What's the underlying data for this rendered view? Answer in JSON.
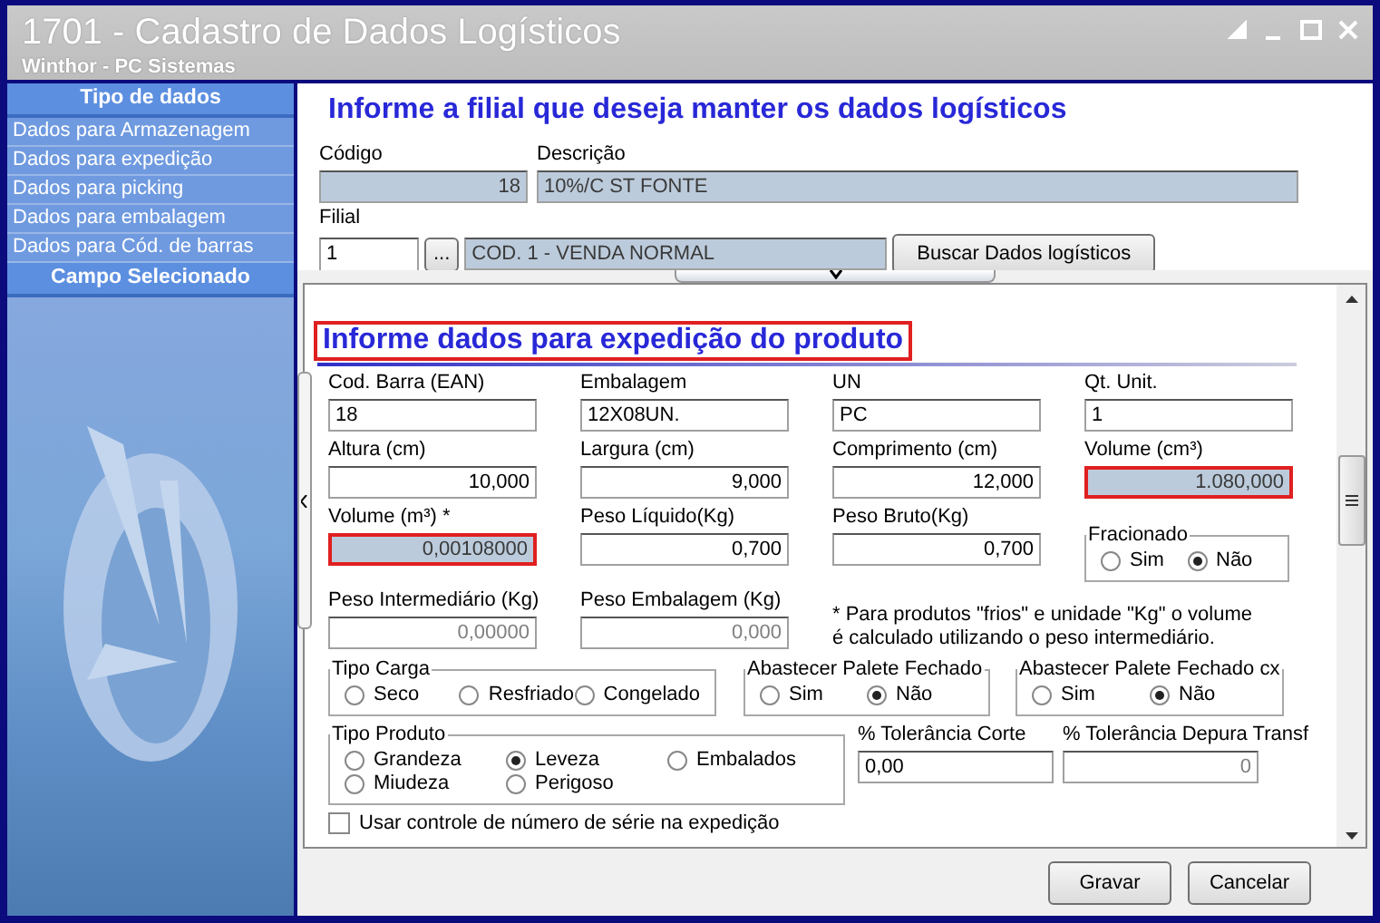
{
  "window": {
    "title": "1701 - Cadastro de Dados Logísticos",
    "subtitle": "Winthor - PC Sistemas"
  },
  "sidebar": {
    "header": "Tipo de dados",
    "items": [
      "Dados para Armazenagem",
      "Dados para expedição",
      "Dados para picking",
      "Dados para embalagem",
      "Dados para Cód. de barras"
    ],
    "footer_header": "Campo Selecionado"
  },
  "filial_section": {
    "heading": "Informe a filial que deseja manter os dados logísticos",
    "codigo": {
      "label": "Código",
      "value": "18",
      "readonly": true
    },
    "descricao": {
      "label": "Descrição",
      "value": "10%/C ST FONTE",
      "readonly": true
    },
    "filial": {
      "label": "Filial",
      "value": "1",
      "lookup_button": "...",
      "description": "COD. 1 - VENDA NORMAL"
    },
    "search_button": "Buscar Dados logísticos"
  },
  "expedicao": {
    "heading": "Informe dados para expedição do produto",
    "highlighted": true,
    "rows": [
      [
        {
          "kind": "text_field",
          "label": "Cod. Barra (EAN)",
          "value": "18"
        },
        {
          "kind": "text_field",
          "label": "Embalagem",
          "value": "12X08UN."
        },
        {
          "kind": "text_field",
          "label": "UN",
          "value": "PC"
        },
        {
          "kind": "text_field",
          "label": "Qt. Unit.",
          "value": "1"
        }
      ],
      [
        {
          "kind": "number_field",
          "label": "Altura (cm)",
          "value": "10,000"
        },
        {
          "kind": "number_field",
          "label": "Largura (cm)",
          "value": "9,000"
        },
        {
          "kind": "number_field",
          "label": "Comprimento (cm)",
          "value": "12,000"
        },
        {
          "kind": "number_field",
          "label": "Volume (cm³)",
          "value": "1.080,000",
          "readonly": true,
          "highlighted": true
        }
      ],
      [
        {
          "kind": "number_field",
          "label": "Volume (m³) *",
          "value": "0,00108000",
          "readonly": true,
          "highlighted": true
        },
        {
          "kind": "number_field",
          "label": "Peso Líquido(Kg)",
          "value": "0,700"
        },
        {
          "kind": "number_field",
          "label": "Peso Bruto(Kg)",
          "value": "0,700"
        },
        {
          "kind": "radio_group",
          "label": "Fracionado",
          "options": [
            {
              "label": "Sim",
              "selected": false
            },
            {
              "label": "Não",
              "selected": true
            }
          ]
        }
      ],
      [
        {
          "kind": "number_field",
          "label": "Peso Intermediário (Kg)",
          "value": "0,00000",
          "disabled": true
        },
        {
          "kind": "number_field",
          "label": "Peso Embalagem (Kg)",
          "value": "0,000",
          "disabled": true
        },
        {
          "kind": "note",
          "lines": [
            "* Para produtos \"frios\" e unidade \"Kg\" o volume",
            "é calculado utilizando o peso intermediário."
          ]
        }
      ],
      [
        {
          "kind": "radio_group",
          "label": "Tipo Carga",
          "options": [
            {
              "label": "Seco",
              "selected": false
            },
            {
              "label": "Resfriado",
              "selected": false
            },
            {
              "label": "Congelado",
              "selected": false
            }
          ]
        },
        {
          "kind": "radio_group",
          "label": "Abastecer Palete Fechado",
          "options": [
            {
              "label": "Sim",
              "selected": false
            },
            {
              "label": "Não",
              "selected": true
            }
          ]
        },
        {
          "kind": "radio_group",
          "label": "Abastecer Palete Fechado cx",
          "options": [
            {
              "label": "Sim",
              "selected": false
            },
            {
              "label": "Não",
              "selected": true
            }
          ]
        }
      ],
      [
        {
          "kind": "radio_group",
          "label": "Tipo Produto",
          "options": [
            {
              "label": "Grandeza",
              "selected": false
            },
            {
              "label": "Leveza",
              "selected": true
            },
            {
              "label": "Embalados",
              "selected": false
            },
            {
              "label": "Miudeza",
              "selected": false
            },
            {
              "label": "Perigoso",
              "selected": false
            }
          ]
        },
        {
          "kind": "text_field",
          "label": "% Tolerância Corte",
          "value": "0,00"
        },
        {
          "kind": "number_field",
          "label": "% Tolerância Depura Transf",
          "value": "0",
          "disabled": true
        }
      ],
      [
        {
          "kind": "checkbox",
          "label": "Usar controle de número de série na expedição",
          "checked": false
        }
      ]
    ]
  },
  "buttons": [
    "Gravar",
    "Cancelar"
  ]
}
